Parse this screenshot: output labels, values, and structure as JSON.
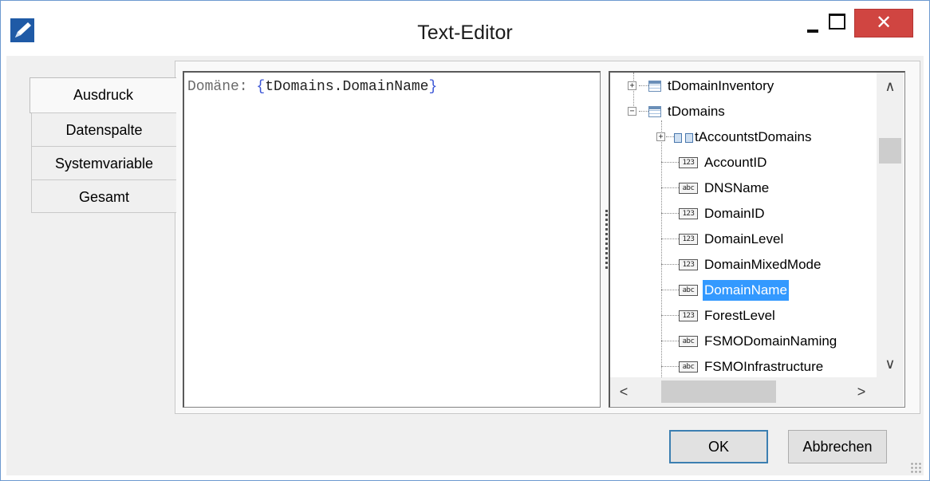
{
  "window": {
    "title": "Text-Editor",
    "close_glyph": "✕",
    "accent_close": "#d04541"
  },
  "tabs": [
    {
      "label": "Ausdruck",
      "active": true
    },
    {
      "label": "Datenspalte",
      "active": false
    },
    {
      "label": "Systemvariable",
      "active": false
    },
    {
      "label": "Gesamt",
      "active": false
    }
  ],
  "editor": {
    "prefix": "Domäne: ",
    "open_brace": "{",
    "expression": "tDomains.DomainName",
    "close_brace": "}",
    "colors": {
      "plain": "#6b6b6b",
      "brace": "#3b55d6"
    }
  },
  "tree": {
    "items": [
      {
        "label": "tDomainInventory",
        "icon": "table-icon",
        "expander": "+"
      },
      {
        "label": "tDomains",
        "icon": "table-icon",
        "expander": "−"
      },
      {
        "label": "tAccountstDomains",
        "icon": "relation-icon",
        "expander": "+"
      },
      {
        "label": "AccountID",
        "icon": "number-type-icon",
        "badge": "123"
      },
      {
        "label": "DNSName",
        "icon": "text-type-icon",
        "badge": "abc"
      },
      {
        "label": "DomainID",
        "icon": "number-type-icon",
        "badge": "123"
      },
      {
        "label": "DomainLevel",
        "icon": "number-type-icon",
        "badge": "123"
      },
      {
        "label": "DomainMixedMode",
        "icon": "number-type-icon",
        "badge": "123"
      },
      {
        "label": "DomainName",
        "icon": "text-type-icon",
        "badge": "abc",
        "selected": true
      },
      {
        "label": "ForestLevel",
        "icon": "number-type-icon",
        "badge": "123"
      },
      {
        "label": "FSMODomainNaming",
        "icon": "text-type-icon",
        "badge": "abc"
      },
      {
        "label": "FSMOInfrastructure",
        "icon": "text-type-icon",
        "badge": "abc"
      }
    ],
    "selection_color": "#3399ff",
    "scroll_glyphs": {
      "up": "∧",
      "down": "∨",
      "left": "<",
      "right": ">"
    }
  },
  "buttons": {
    "ok": "OK",
    "cancel": "Abbrechen"
  }
}
